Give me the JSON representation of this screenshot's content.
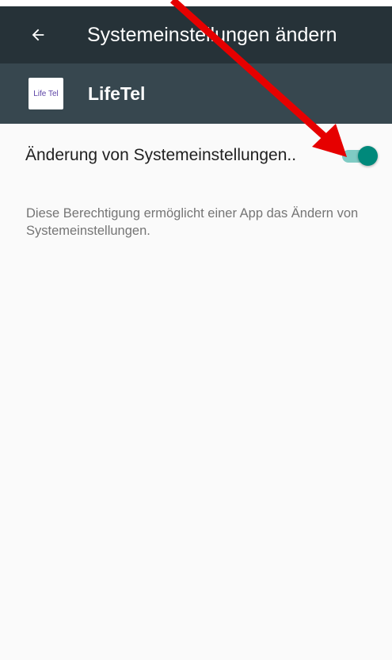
{
  "app_bar": {
    "back_icon": "arrow-back-icon",
    "title": "Systemeinstellungen ändern"
  },
  "app_header": {
    "icon_text": "Life Tel",
    "name": "LifeTel"
  },
  "setting": {
    "label": "Änderung von Systemeinstellungen..",
    "toggle_on": true,
    "description": "Diese Berechtigung ermöglicht einer App das Ändern von Systemeinstellungen."
  },
  "colors": {
    "app_bar": "#263238",
    "app_header": "#37474f",
    "accent": "#00897b",
    "toggle_track": "#80cbc4",
    "annotation_arrow": "#e60000"
  }
}
